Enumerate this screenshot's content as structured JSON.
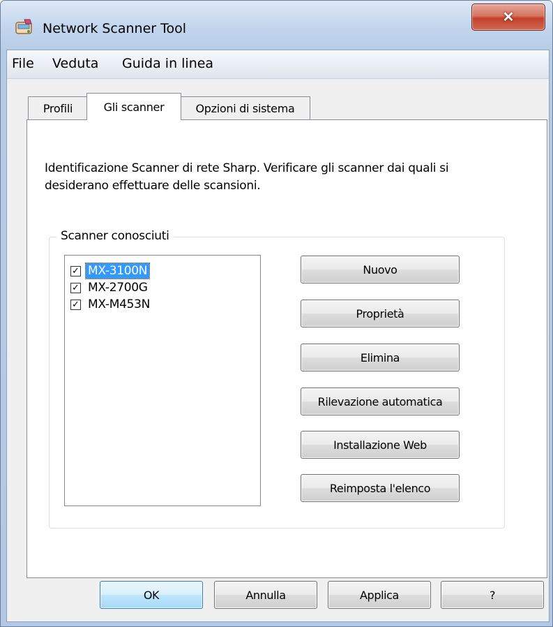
{
  "window": {
    "title": "Network Scanner Tool"
  },
  "menu": {
    "items": [
      {
        "label": "File"
      },
      {
        "label": "Veduta"
      },
      {
        "label": "Guida in linea"
      }
    ]
  },
  "tabs": [
    {
      "label": "Profili"
    },
    {
      "label": "Gli scanner"
    },
    {
      "label": "Opzioni di sistema"
    }
  ],
  "active_tab": "Gli scanner",
  "description": "Identificazione Scanner di rete Sharp. Verificare gli scanner dai quali si desiderano effettuare delle scansioni.",
  "group": {
    "legend": "Scanner conosciuti",
    "scanners": [
      {
        "name": "MX-3100N",
        "checked": true,
        "selected": true
      },
      {
        "name": "MX-2700G",
        "checked": true,
        "selected": false
      },
      {
        "name": "MX-M453N",
        "checked": true,
        "selected": false
      }
    ]
  },
  "side_buttons": [
    {
      "label": "Nuovo"
    },
    {
      "label": "Proprietà"
    },
    {
      "label": "Elimina"
    },
    {
      "label": "Rilevazione automatica"
    },
    {
      "label": "Installazione Web"
    },
    {
      "label": "Reimposta l'elenco"
    }
  ],
  "bottom_buttons": {
    "ok": "OK",
    "cancel": "Annulla",
    "apply": "Applica",
    "help": "?"
  },
  "colors": {
    "selection": "#3399ff",
    "close_button": "#c2402a",
    "default_button_border": "#3c7fb1"
  }
}
